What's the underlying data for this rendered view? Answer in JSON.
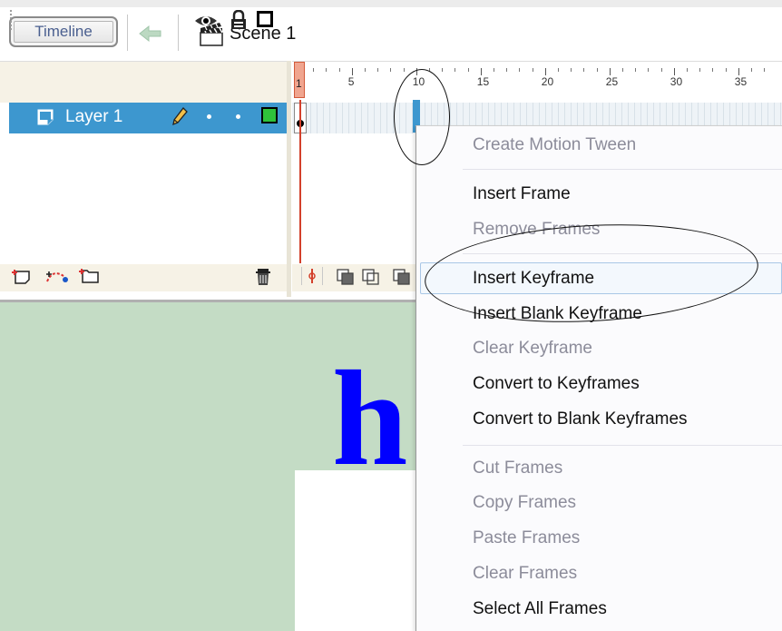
{
  "toolbar": {
    "timeline_label": "Timeline",
    "scene_label": "Scene 1",
    "back_icon": "back-arrow-icon",
    "scene_icon": "clapperboard-icon"
  },
  "layer_header": {
    "icons": [
      "eye-icon",
      "lock-icon",
      "outline-icon"
    ]
  },
  "ruler": {
    "current_frame": "1",
    "numbers": [
      "5",
      "10",
      "15",
      "20",
      "25",
      "30",
      "35"
    ]
  },
  "layers": [
    {
      "name": "Layer 1",
      "color": "#2fc23a",
      "selected": true
    }
  ],
  "colors": {
    "selection": "#3d97cf",
    "playhead": "#d3402b",
    "stage": "#c4dcc5",
    "stage_text": "#0000ff"
  },
  "stage": {
    "text": "h"
  },
  "context_menu": {
    "items": [
      {
        "label": "Create Motion Tween",
        "enabled": false
      },
      {
        "label": "Insert Frame",
        "enabled": true
      },
      {
        "label": "Remove Frames",
        "enabled": false
      },
      {
        "label": "Insert Keyframe",
        "enabled": true,
        "highlighted": true
      },
      {
        "label": "Insert Blank Keyframe",
        "enabled": true
      },
      {
        "label": "Clear Keyframe",
        "enabled": false
      },
      {
        "label": "Convert to Keyframes",
        "enabled": true
      },
      {
        "label": "Convert to Blank Keyframes",
        "enabled": true
      },
      {
        "label": "Cut Frames",
        "enabled": false
      },
      {
        "label": "Copy Frames",
        "enabled": false
      },
      {
        "label": "Paste Frames",
        "enabled": false
      },
      {
        "label": "Clear Frames",
        "enabled": false
      },
      {
        "label": "Select All Frames",
        "enabled": true
      }
    ]
  }
}
